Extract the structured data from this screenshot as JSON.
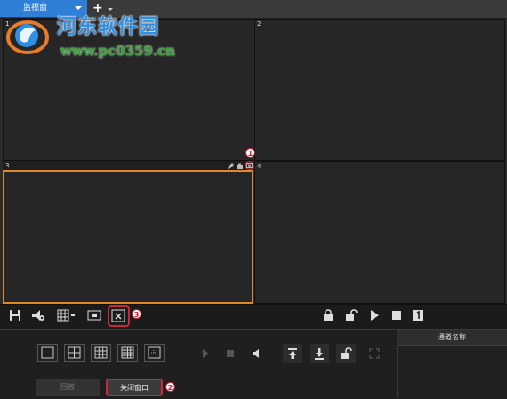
{
  "tabs": {
    "active_label": "监视窗",
    "add_label": "+"
  },
  "watermark": {
    "title": "河东软件园",
    "url": "www.pc0359.cn"
  },
  "panes": {
    "p1": "1",
    "p2": "2",
    "p3": "3",
    "p4": "4"
  },
  "callouts": {
    "c1": "1",
    "c2": "2",
    "c3": "3"
  },
  "toolbar": {
    "left_icons": [
      "save-icon",
      "snapshot-config-icon",
      "grid-layout-icon",
      "fullscreen-window-icon",
      "close-window-icon"
    ],
    "right_icons": [
      "lock-icon",
      "unlock-icon",
      "play-icon",
      "stop-icon",
      "one-window-icon"
    ]
  },
  "bottom": {
    "layouts": [
      "1x1",
      "2x2",
      "3x3",
      "4x4",
      "custom"
    ],
    "controls": [
      "play",
      "stop",
      "volume",
      "upload",
      "download",
      "unlock",
      "fullscreen"
    ],
    "prev_label": "回放",
    "close_window_label": "关闭窗口",
    "channel_header": "通道名称"
  },
  "colors": {
    "accent_tab": "#2f7fd6",
    "selected_pane": "#e08a2c",
    "annotation": "#c8283a"
  }
}
